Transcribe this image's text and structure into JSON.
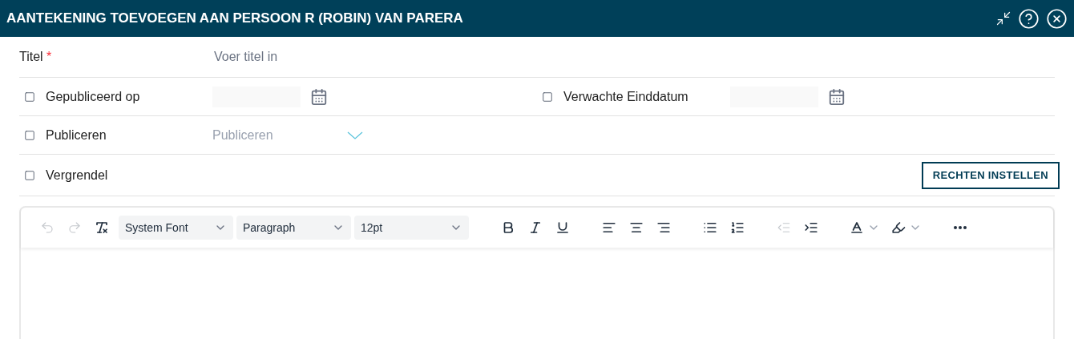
{
  "window": {
    "title": "AANTEKENING TOEVOEGEN AAN PERSOON R (ROBIN) VAN PARERA"
  },
  "title_field": {
    "label": "Titel",
    "required_mark": "*",
    "placeholder": "Voer titel in"
  },
  "date_fields": [
    {
      "label": "Gepubliceerd op",
      "checked": false
    },
    {
      "label": "Verwachte Einddatum",
      "checked": false
    }
  ],
  "publish": {
    "label": "Publiceren",
    "checked": false,
    "placeholder": "Publiceren"
  },
  "lock": {
    "label": "Vergrendel",
    "checked": false
  },
  "rights_button": "RECHTEN INSTELLEN",
  "toolbar": [
    {
      "kind": "undo",
      "disabled": true
    },
    {
      "kind": "redo",
      "disabled": true
    },
    {
      "kind": "clear",
      "disabled": false
    },
    {
      "kind": "select",
      "value": "System Font"
    },
    {
      "kind": "select",
      "value": "Paragraph"
    },
    {
      "kind": "select",
      "value": "12pt"
    },
    {
      "kind": "bold",
      "disabled": false
    },
    {
      "kind": "italic",
      "disabled": false
    },
    {
      "kind": "underline",
      "disabled": false
    },
    {
      "kind": "align-left",
      "disabled": false
    },
    {
      "kind": "align-center",
      "disabled": false
    },
    {
      "kind": "align-right",
      "disabled": false
    },
    {
      "kind": "bullets",
      "disabled": false
    },
    {
      "kind": "numbers",
      "disabled": false
    },
    {
      "kind": "outdent",
      "disabled": true
    },
    {
      "kind": "indent",
      "disabled": false
    },
    {
      "kind": "text-color",
      "disabled": false
    },
    {
      "kind": "highlight",
      "disabled": false
    },
    {
      "kind": "more",
      "disabled": false
    }
  ]
}
